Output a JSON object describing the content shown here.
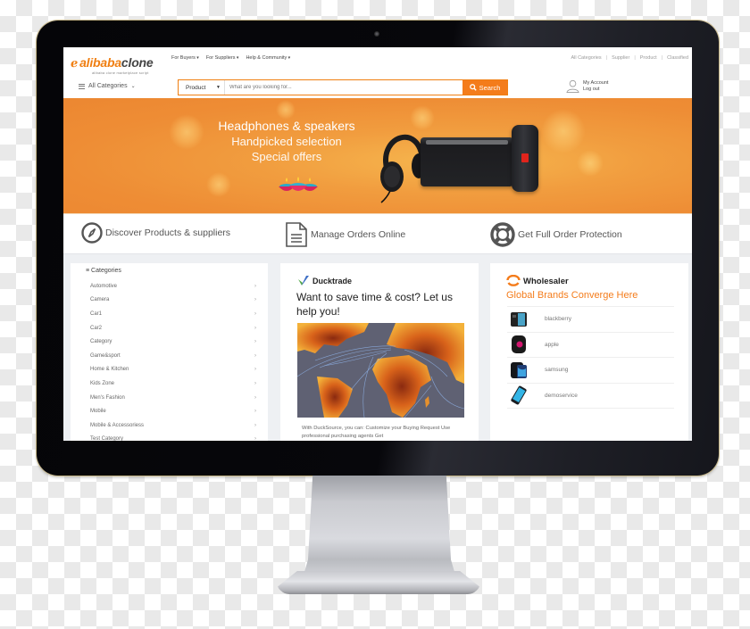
{
  "header": {
    "logo": {
      "prefix": "alibaba",
      "suffix": "clone",
      "tagline": "alibaba clone marketplace script"
    },
    "nav": [
      {
        "label": "For Buyers"
      },
      {
        "label": "For Suppliers"
      },
      {
        "label": "Help & Community"
      }
    ],
    "top_links": [
      {
        "label": "All Categories"
      },
      {
        "label": "Supplier"
      },
      {
        "label": "Product"
      },
      {
        "label": "Classified"
      }
    ],
    "separator": "|",
    "all_categories_label": "All Categories",
    "search": {
      "scope_selected": "Product",
      "placeholder": "What are you looking for...",
      "value": "",
      "button_label": "Search"
    },
    "account": {
      "my_account": "My Account",
      "logout": "Log out"
    }
  },
  "banner": {
    "line1": "Headphones & speakers",
    "line2": "Handpicked selection",
    "line3": "Special offers"
  },
  "features": [
    {
      "icon": "compass-icon",
      "label": "Discover Products & suppliers"
    },
    {
      "icon": "document-icon",
      "label": "Manage Orders Online"
    },
    {
      "icon": "lifebuoy-icon",
      "label": "Get Full Order Protection"
    }
  ],
  "categories": {
    "title": "Categories",
    "items": [
      {
        "label": "Automotive"
      },
      {
        "label": "Camera"
      },
      {
        "label": "Car1"
      },
      {
        "label": "Car2"
      },
      {
        "label": "Category"
      },
      {
        "label": "Game&sport"
      },
      {
        "label": "Home & Kitchen"
      },
      {
        "label": "Kids Zone"
      },
      {
        "label": "Men's Fashion"
      },
      {
        "label": "Mobile"
      },
      {
        "label": "Mobile & Accessoriess"
      },
      {
        "label": "Test Category"
      }
    ],
    "chevron": "›"
  },
  "ducktrade": {
    "brand": "Ducktrade",
    "headline": "Want to save time & cost? Let us help you!",
    "description": "With DuckSource, you can: Customize your Buying Request Use professional purchasing agents Get"
  },
  "wholesaler": {
    "brand": "Wholesaler",
    "tagline": "Global Brands Converge Here",
    "items": [
      {
        "label": "blackberry"
      },
      {
        "label": "apple"
      },
      {
        "label": "samsung"
      },
      {
        "label": "demoservice"
      }
    ]
  },
  "colors": {
    "accent": "#f47c1b",
    "banner": "#ef9238",
    "bezel": "#07070b"
  }
}
